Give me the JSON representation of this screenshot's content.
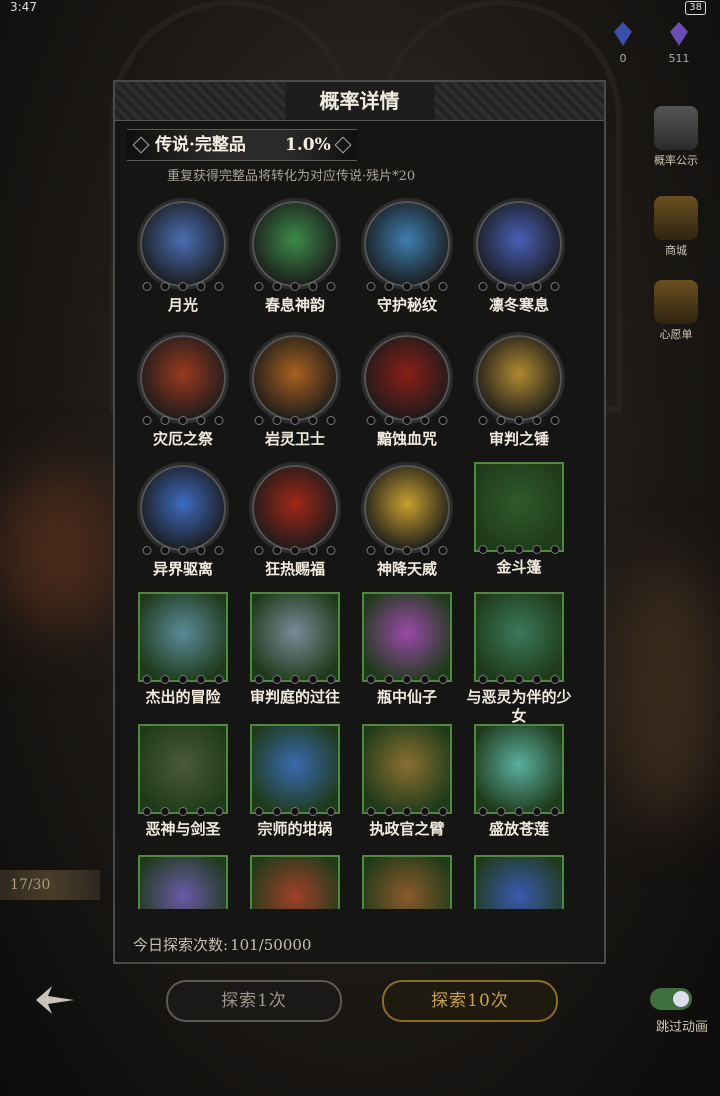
{
  "status": {
    "time": "3:47",
    "battery": "38"
  },
  "currency": [
    {
      "icon": "blue-gem-icon",
      "value": "0",
      "color": "#3b4fa8"
    },
    {
      "icon": "purple-gem-icon",
      "value": "511",
      "color": "#6a4cb2"
    }
  ],
  "side_buttons": [
    {
      "label": "概率公示",
      "icon": "probability-icon"
    },
    {
      "label": "商城",
      "icon": "shop-icon"
    },
    {
      "label": "心愿单",
      "icon": "wishlist-icon"
    }
  ],
  "side_counter": "17/30",
  "modal": {
    "title": "概率详情",
    "rarity": {
      "name": "传说·完整品",
      "rate": "1.0%"
    },
    "note": "重复获得完整品将转化为对应传说·残片*20",
    "items": [
      {
        "name": "月光",
        "shape": "circle",
        "color": "#4a6fb4"
      },
      {
        "name": "春息神韵",
        "shape": "circle",
        "color": "#3d8b4a"
      },
      {
        "name": "守护秘纹",
        "shape": "circle",
        "color": "#3c7fb0"
      },
      {
        "name": "凛冬寒息",
        "shape": "circle",
        "color": "#4860b8"
      },
      {
        "name": "灾厄之祭",
        "shape": "circle",
        "color": "#9a3a20"
      },
      {
        "name": "岩灵卫士",
        "shape": "circle",
        "color": "#a8621f"
      },
      {
        "name": "黯蚀血咒",
        "shape": "circle",
        "color": "#8a1f18"
      },
      {
        "name": "审判之锤",
        "shape": "circle",
        "color": "#b08a30"
      },
      {
        "name": "异界驱离",
        "shape": "circle",
        "color": "#3e6cc0"
      },
      {
        "name": "狂热赐福",
        "shape": "circle",
        "color": "#a02818"
      },
      {
        "name": "神降天威",
        "shape": "circle",
        "color": "#c8a030"
      },
      {
        "name": "金斗篷",
        "shape": "square",
        "color": "#2f5a2a"
      },
      {
        "name": "杰出的冒险",
        "shape": "square",
        "color": "#5a8a9a"
      },
      {
        "name": "审判庭的过往",
        "shape": "square",
        "color": "#7a8a98"
      },
      {
        "name": "瓶中仙子",
        "shape": "square",
        "color": "#9a4aa8"
      },
      {
        "name": "与恶灵为伴的少女",
        "shape": "square",
        "color": "#3a7a5a"
      },
      {
        "name": "恶神与剑圣",
        "shape": "square",
        "color": "#4a5a3a"
      },
      {
        "name": "宗师的坩埚",
        "shape": "square",
        "color": "#3a6ab0"
      },
      {
        "name": "执政官之臂",
        "shape": "square",
        "color": "#8a7030"
      },
      {
        "name": "盛放苍莲",
        "shape": "square",
        "color": "#5ab0a0"
      },
      {
        "name": "",
        "shape": "square",
        "color": "#6a5aa8"
      },
      {
        "name": "",
        "shape": "square",
        "color": "#a0402a"
      },
      {
        "name": "",
        "shape": "square",
        "color": "#8a5a2a"
      },
      {
        "name": "",
        "shape": "square",
        "color": "#3a5ab0"
      }
    ],
    "footer_label": "今日探索次数:",
    "footer_value": "101/50000"
  },
  "bottom": {
    "explore_once": "探索1次",
    "explore_ten": "探索10次",
    "skip_animation": "跳过动画"
  }
}
